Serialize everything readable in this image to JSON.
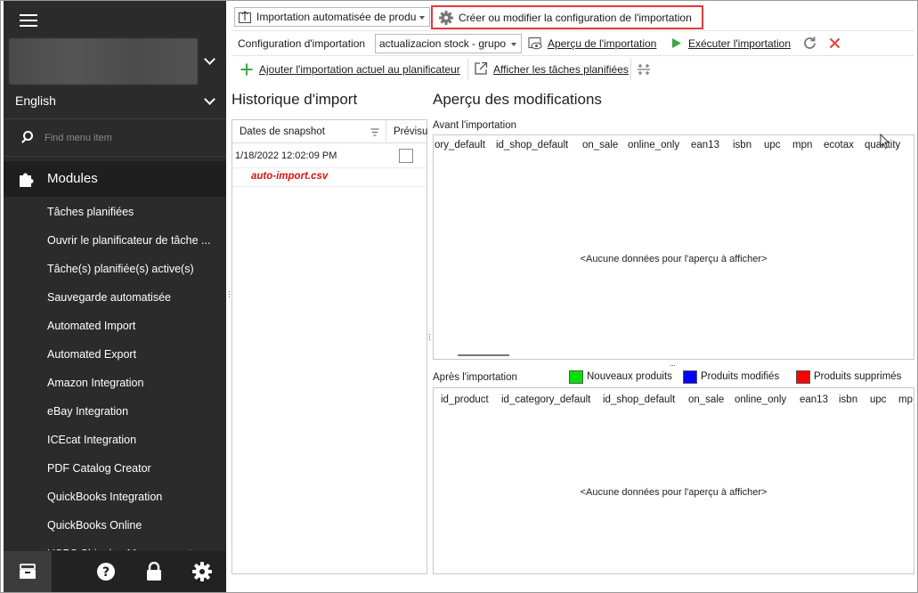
{
  "sidebar": {
    "language": "English",
    "search_placeholder": "Find menu item",
    "section_label": "Modules",
    "items": [
      "Tâches planifiées",
      "Ouvrir le planificateur de tâche ...",
      "Tâche(s) planifiée(s) active(s)",
      "Sauvegarde automatisée",
      "Automated Import",
      "Automated Export",
      "Amazon Integration",
      "eBay Integration",
      "ICEcat Integration",
      "PDF Catalog Creator",
      "QuickBooks Integration",
      "QuickBooks Online",
      "USPS Shipping Management"
    ]
  },
  "toolbar": {
    "import_type": "Importation automatisée de produ",
    "create_config_label": "Créer ou modifier la configuration de l'importation",
    "config_label": "Configuration d'importation",
    "config_value": "actualizacion stock - grupo",
    "preview_label": "Aperçu de l'importation",
    "run_label": "Exécuter l'importation",
    "add_scheduler_label": "Ajouter l'importation actuel au planificateur",
    "show_tasks_label": "Afficher les tâches planifiées"
  },
  "history": {
    "title": "Historique d'import",
    "col_snapshot": "Dates de snapshot",
    "col_preview": "Prévisu",
    "rows": [
      {
        "date": "1/18/2022 12:02:09 PM",
        "file": "auto-import.csv"
      }
    ]
  },
  "preview": {
    "title": "Aperçu des modifications",
    "before_label": "Avant l'importation",
    "before_columns": [
      "ory_default",
      "id_shop_default",
      "on_sale",
      "online_only",
      "ean13",
      "isbn",
      "upc",
      "mpn",
      "ecotax",
      "quantity"
    ],
    "after_label": "Après l'importation",
    "after_columns": [
      "id_product",
      "id_category_default",
      "id_shop_default",
      "on_sale",
      "online_only",
      "ean13",
      "isbn",
      "upc",
      "mp"
    ],
    "empty_message": "<Aucune données pour l'aperçu à afficher>",
    "legend": [
      {
        "label": "Nouveaux produits",
        "color": "#00e000"
      },
      {
        "label": "Produits modifiés",
        "color": "#0000ff"
      },
      {
        "label": "Produits supprimés",
        "color": "#ff0000"
      }
    ]
  }
}
